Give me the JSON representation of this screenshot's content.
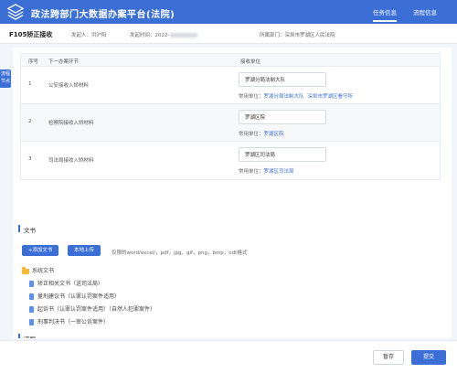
{
  "header": {
    "title": "政法跨部门大数据办案平台(法院)",
    "nav": [
      "任务信息",
      "流程信息"
    ],
    "accent": "#3b6fd6"
  },
  "info_bar": {
    "case_title": "F105矫正接收",
    "initiator": "发起人：洪沪阳",
    "time_prefix": "发起时间：2022-",
    "unit": "所属部门：深圳市罗湖区人民法院"
  },
  "side_tab": "流程节点",
  "table": {
    "headers": [
      "序号",
      "下一办案环节",
      "接收单位"
    ],
    "common_label": "常用单位：",
    "rows": [
      {
        "num": "1",
        "step": "公安接收入矫材料",
        "unit": "罗湖分局法制大队",
        "common": [
          "罗湖分局法制大队",
          "深圳市罗湖区看守所"
        ]
      },
      {
        "num": "2",
        "step": "检察院接收入矫材料",
        "unit": "罗湖区院",
        "common": [
          "罗湖区院"
        ]
      },
      {
        "num": "3",
        "step": "司法局接收入矫材料",
        "unit": "罗湖区司法局",
        "common": [
          "罗湖区司法局"
        ]
      }
    ]
  },
  "documents": {
    "section_title": "文书",
    "add_button": "+添加文书",
    "upload_button": "本地上传",
    "hint": "仅限的word/excel/，pdf，jpg，gif，png，bmp，odt格式",
    "folder": "系统文书",
    "files": [
      "矫正相关文书（送司法局）",
      "量刑建议书（认罪认罚案件适用）",
      "起诉书（认罪认罚案件适用）（自然人犯罪案件）",
      "刑事判决书（一审公诉案件）"
    ]
  },
  "next_section": "流程",
  "footer": {
    "save": "暂存",
    "submit": "提交"
  }
}
